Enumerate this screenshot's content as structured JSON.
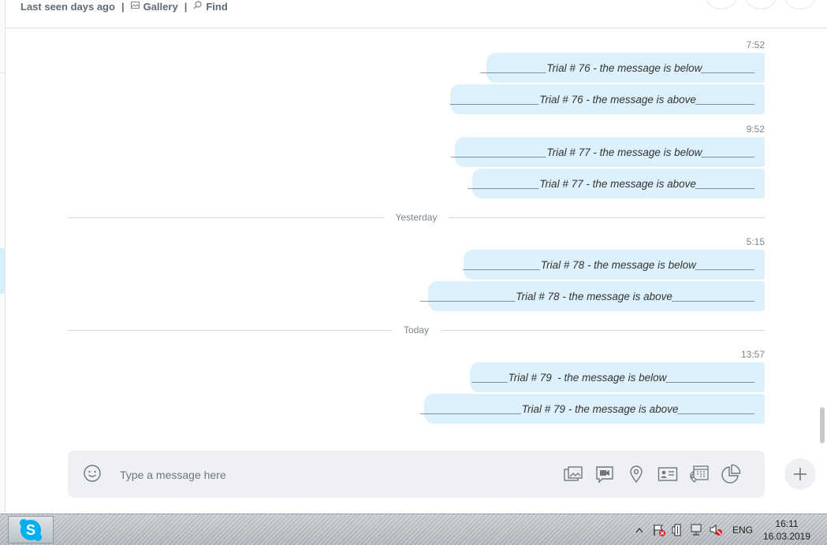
{
  "header": {
    "status": "Last seen days ago",
    "separator": "|",
    "gallery_label": "Gallery",
    "find_label": "Find"
  },
  "messages": [
    {
      "time": "7:52",
      "lines": [
        "___________Trial # 76 - the message is below_________",
        "_______________Trial # 76 - the message is above__________"
      ]
    },
    {
      "time": "9:52",
      "lines": [
        "________________Trial # 77 - the message is below_________",
        "____________Trial # 77 - the message is above__________"
      ]
    },
    {
      "divider": "Yesterday"
    },
    {
      "time": "5:15",
      "lines": [
        "_____________Trial # 78 - the message is below__________",
        "________________Trial # 78 - the message is above______________"
      ]
    },
    {
      "divider": "Today"
    },
    {
      "time": "13:57",
      "lines": [
        "______Trial # 79  - the message is below_______________",
        "_________________Trial # 79 - the message is above_____________"
      ]
    }
  ],
  "compose": {
    "placeholder": "Type a message here",
    "icons": [
      "emoji-icon",
      "media-gallery-icon",
      "video-message-icon",
      "location-icon",
      "contact-card-icon",
      "schedule-call-icon",
      "poll-icon",
      "plus-icon"
    ]
  },
  "taskbar": {
    "language": "ENG",
    "time": "16:11",
    "date": "16.03.2019"
  },
  "colors": {
    "bubble": "#dcf1fb",
    "compose_bg": "#eef0f3",
    "skype_blue": "#00aff0"
  }
}
